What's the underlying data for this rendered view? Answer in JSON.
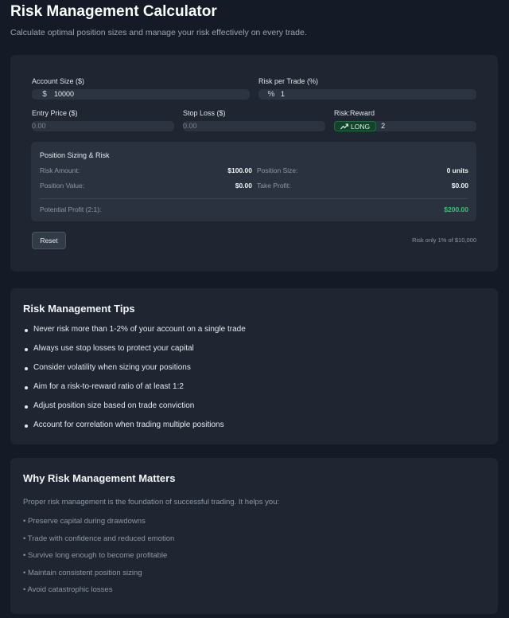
{
  "header": {
    "title": "Risk Management Calculator",
    "subtitle": "Calculate optimal position sizes and manage your risk effectively on every trade."
  },
  "calculator": {
    "account_size": {
      "label": "Account Size ($)",
      "icon": "dollar-icon",
      "value": "10000"
    },
    "risk_per_trade": {
      "label": "Risk per Trade (%)",
      "icon": "percent-icon",
      "value": "1"
    },
    "entry_price": {
      "label": "Entry Price ($)",
      "placeholder": "0.00"
    },
    "stop_loss": {
      "label": "Stop Loss ($)",
      "placeholder": "0.00"
    },
    "risk_reward": {
      "label": "Risk:Reward",
      "direction": "LONG",
      "direction_icon": "trending-up-icon",
      "value": "2",
      "accent": "#35c46b"
    },
    "results": {
      "title": "Position Sizing & Risk",
      "risk_amount_label": "Risk Amount:",
      "risk_amount_value": "$100.00",
      "position_size_label": "Position Size:",
      "position_size_value": "0 units",
      "position_value_label": "Position Value:",
      "position_value_value": "$0.00",
      "take_profit_label": "Take Profit:",
      "take_profit_value": "$0.00",
      "potential_profit_label": "Potential Profit (2:1):",
      "potential_profit_value": "$200.00"
    },
    "reset_label": "Reset",
    "risk_note": "Risk only 1% of $10,000"
  },
  "tips": {
    "title": "Risk Management Tips",
    "items": [
      "Never risk more than 1-2% of your account on a single trade",
      "Always use stop losses to protect your capital",
      "Consider volatility when sizing your positions",
      "Aim for a risk-to-reward ratio of at least 1:2",
      "Adjust position size based on trade conviction",
      "Account for correlation when trading multiple positions"
    ]
  },
  "why": {
    "title": "Why Risk Management Matters",
    "intro": "Proper risk management is the foundation of successful trading. It helps you:",
    "items": [
      "• Preserve capital during drawdowns",
      "• Trade with confidence and reduced emotion",
      "• Survive long enough to become profitable",
      "• Maintain consistent position sizing",
      "• Avoid catastrophic losses"
    ]
  }
}
